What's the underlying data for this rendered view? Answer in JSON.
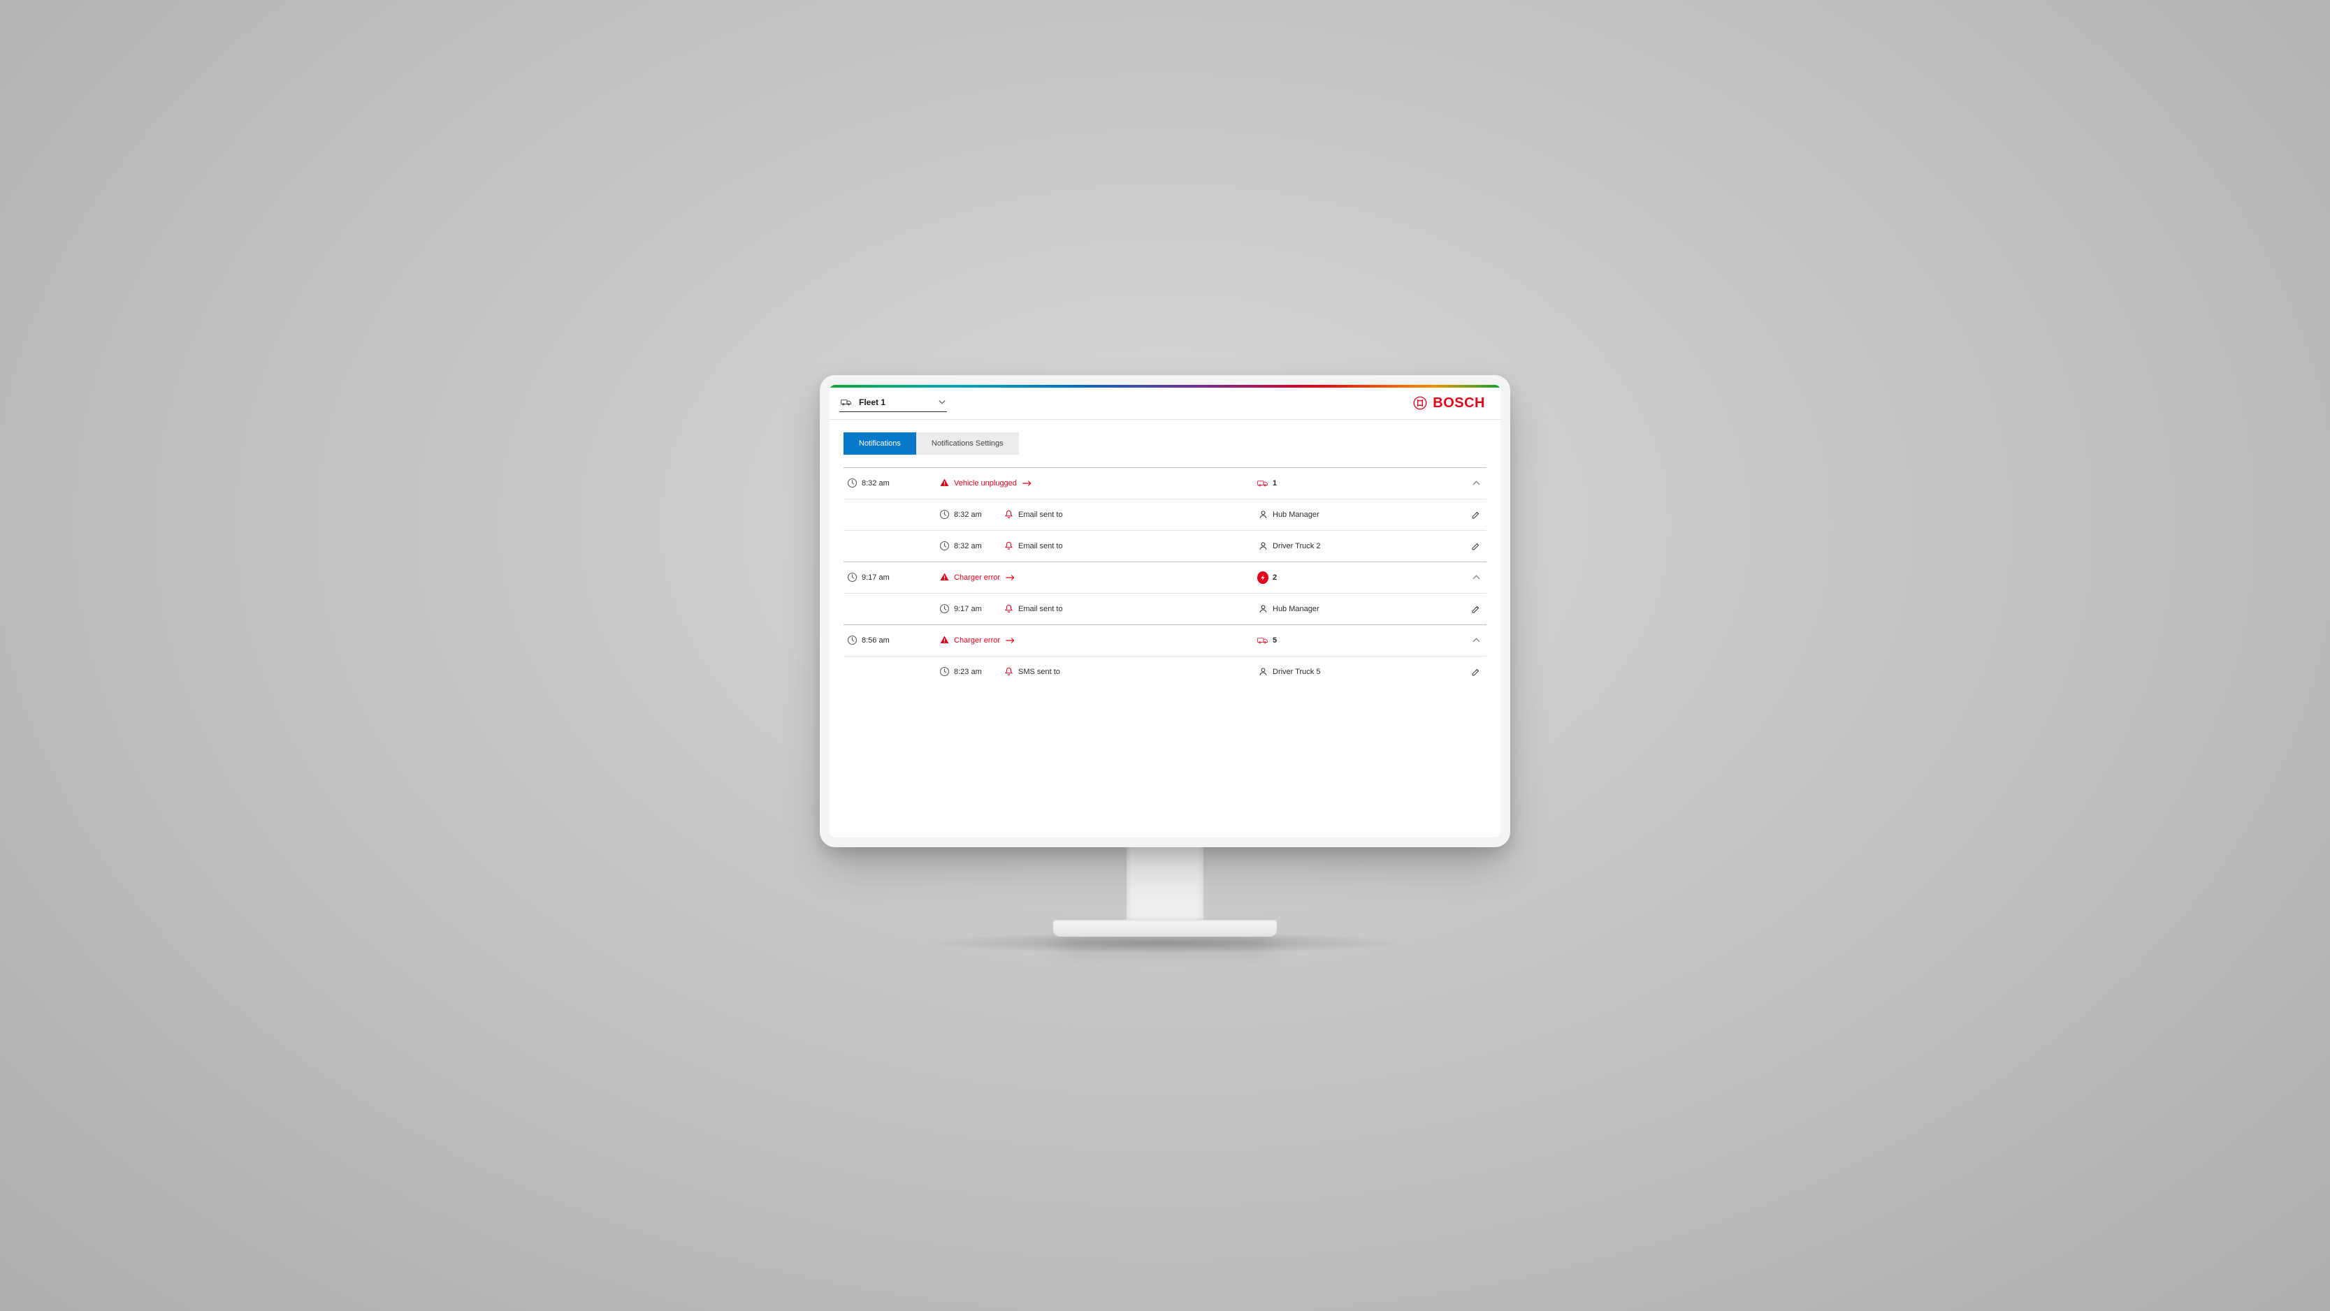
{
  "brand": {
    "name": "BOSCH"
  },
  "header": {
    "fleet_label": "Fleet 1"
  },
  "tabs": {
    "notifications": "Notifications",
    "settings": "Notifications Settings"
  },
  "events": [
    {
      "time": "8:32 am",
      "type": "Vehicle unplugged",
      "asset_kind": "truck",
      "asset_id": "1",
      "actions": [
        {
          "time": "8:32 am",
          "msg": "Email sent to",
          "recipient": "Hub Manager"
        },
        {
          "time": "8:32 am",
          "msg": "Email sent to",
          "recipient": "Driver Truck 2"
        }
      ]
    },
    {
      "time": "9:17 am",
      "type": "Charger error",
      "asset_kind": "charger",
      "asset_id": "2",
      "actions": [
        {
          "time": "9:17 am",
          "msg": "Email sent to",
          "recipient": "Hub Manager"
        }
      ]
    },
    {
      "time": "8:56 am",
      "type": "Charger error",
      "asset_kind": "truck",
      "asset_id": "5",
      "actions": [
        {
          "time": "8:23 am",
          "msg": "SMS sent to",
          "recipient": "Driver Truck 5"
        }
      ]
    }
  ]
}
